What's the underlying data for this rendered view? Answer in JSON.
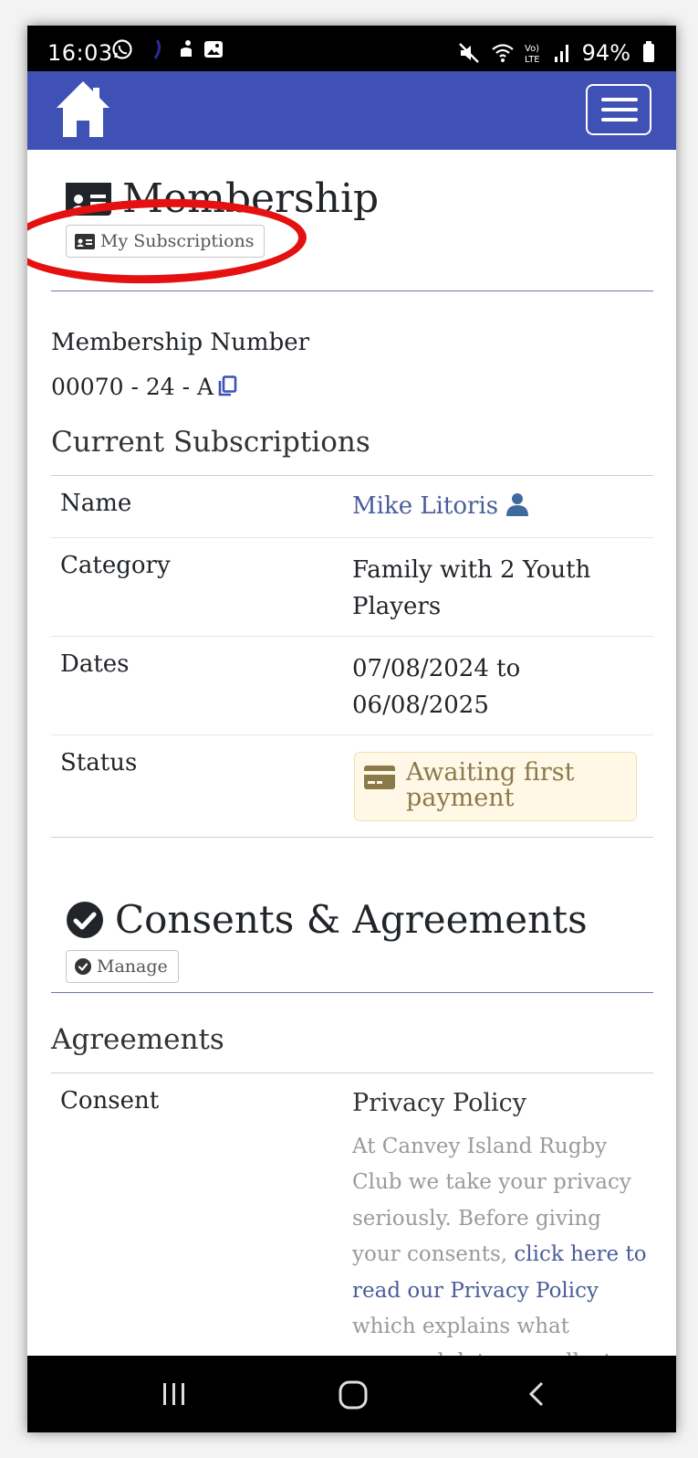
{
  "status_bar": {
    "time": "16:03",
    "battery": "94%",
    "icons": [
      "whatsapp-icon",
      "app-icon",
      "gallery-icon",
      "mute-icon",
      "wifi-icon",
      "volte-icon",
      "signal-icon",
      "battery-icon"
    ]
  },
  "navbar": {
    "color": "#3f51b5",
    "icons": [
      "home-icon",
      "hamburger-menu-icon"
    ]
  },
  "membership": {
    "title": "Membership",
    "my_subscriptions_label": "My Subscriptions",
    "number_label": "Membership Number",
    "number_value": "00070 - 24 - A",
    "current_subscriptions_title": "Current Subscriptions",
    "rows": [
      {
        "label": "Name",
        "value": "Mike Litoris"
      },
      {
        "label": "Category",
        "value": "Family with 2 Youth Players"
      },
      {
        "label": "Dates",
        "value": "07/08/2024 to 06/08/2025"
      },
      {
        "label": "Status",
        "value": "Awaiting first payment"
      }
    ]
  },
  "consents": {
    "title": "Consents & Agreements",
    "manage_label": "Manage",
    "agreements_title": "Agreements",
    "consent_label": "Consent",
    "privacy_title": "Privacy Policy",
    "privacy_text_1": "At Canvey Island Rugby Club we take your privacy seriously. Before giving your consents,",
    "privacy_link": "click here to read our Privacy Policy",
    "privacy_text_2": "which explains what personal data we collect and how we will"
  },
  "colors": {
    "accent": "#3f51b5",
    "link": "#4a5d9a",
    "annotation": "#e51010",
    "status_bg": "#fff8e6"
  }
}
